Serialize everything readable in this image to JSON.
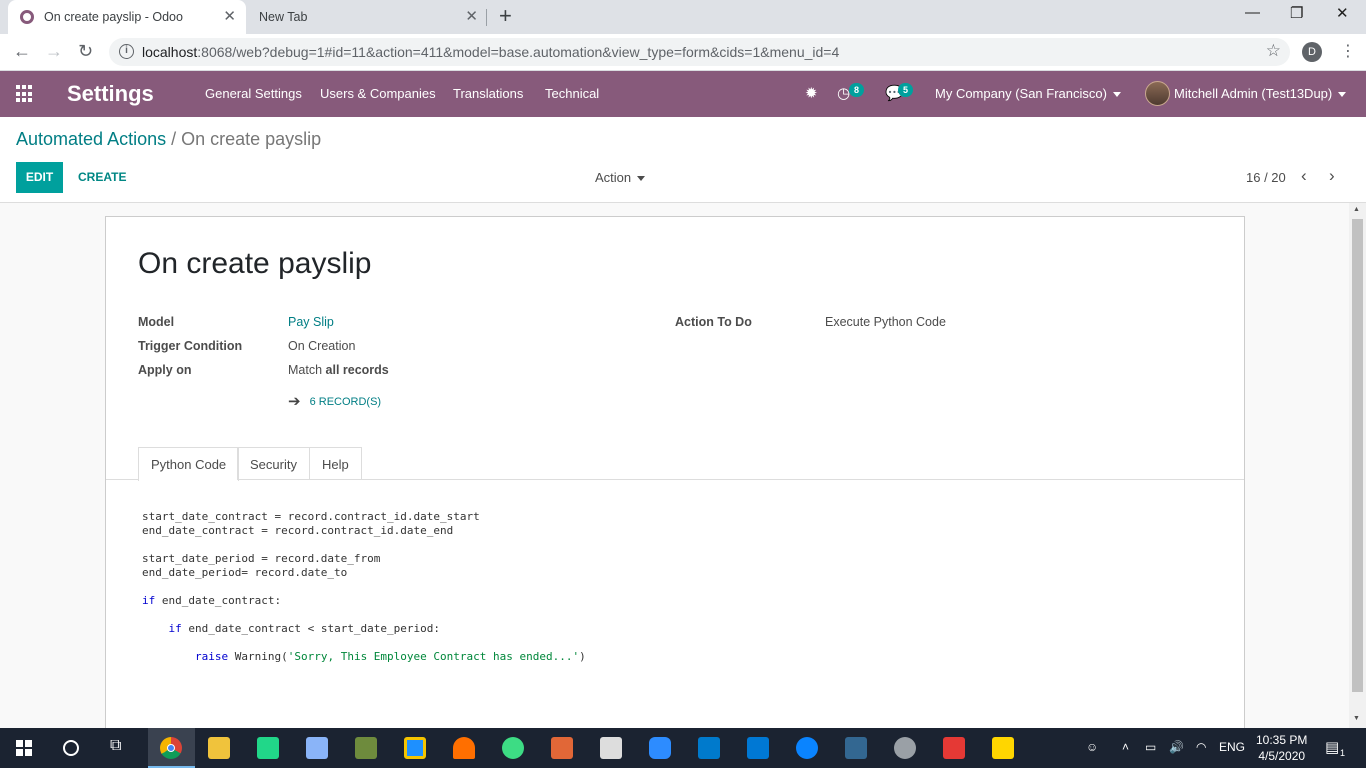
{
  "browser": {
    "active_tab_title": "On create payslip - Odoo",
    "inactive_tab_title": "New Tab",
    "close_glyph": "✕",
    "new_tab_glyph": "+",
    "url_host": "localhost",
    "url_rest": ":8068/web?debug=1#id=11&action=411&model=base.automation&view_type=form&cids=1&menu_id=4",
    "profile_initial": "D"
  },
  "navbar": {
    "brand": "Settings",
    "menu": [
      "General Settings",
      "Users & Companies",
      "Translations",
      "Technical"
    ],
    "activity_count": "8",
    "messages_count": "5",
    "company": "My Company (San Francisco)",
    "user": "Mitchell Admin (Test13Dup)"
  },
  "control_panel": {
    "breadcrumb_parent": "Automated Actions",
    "breadcrumb_separator": "/",
    "breadcrumb_current": "On create payslip",
    "edit_label": "EDIT",
    "create_label": "CREATE",
    "action_label": "Action",
    "pager": "16 / 20"
  },
  "form": {
    "title": "On create payslip",
    "model_label": "Model",
    "model_value": "Pay Slip",
    "trigger_label": "Trigger Condition",
    "trigger_value": "On Creation",
    "apply_label": "Apply on",
    "apply_value_prefix": "Match",
    "apply_value_bold": "all records",
    "action_to_do_label": "Action To Do",
    "action_to_do_value": "Execute Python Code",
    "records_button": "6 RECORD(S)",
    "tabs": [
      "Python Code",
      "Security",
      "Help"
    ],
    "code_lines": {
      "l1": "start_date_contract = record.contract_id.date_start",
      "l2": "end_date_contract = record.contract_id.date_end",
      "l3": "start_date_period = record.date_from",
      "l4": "end_date_period= record.date_to",
      "kw_if": "if",
      "l5_rest": " end_date_contract:",
      "l6_rest": " end_date_contract < start_date_period:",
      "kw_raise": "raise",
      "l7_mid": " Warning(",
      "l7_str": "'Sorry, This Employee Contract has ended...'",
      "l7_end": ")"
    }
  },
  "taskbar": {
    "language": "ENG",
    "time": "10:35 PM",
    "date": "4/5/2020",
    "notification_count": "1"
  },
  "colors": {
    "odoo_purple": "#875a7b",
    "odoo_teal": "#00a09d",
    "link_teal": "#017e84"
  }
}
